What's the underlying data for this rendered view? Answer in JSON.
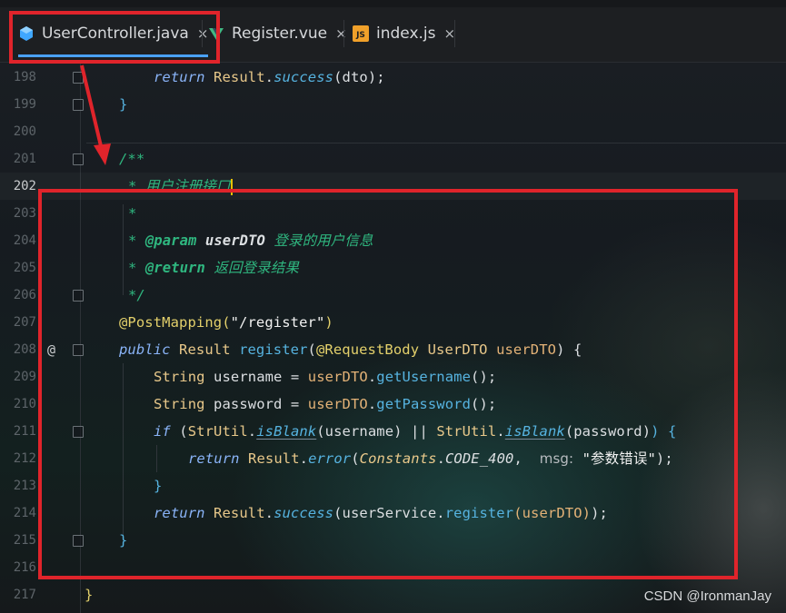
{
  "tabs": [
    {
      "label": "UserController.java",
      "close": "×",
      "icon": "java-class-icon",
      "active": true
    },
    {
      "label": "Register.vue",
      "close": "×",
      "icon": "vue-icon",
      "active": false
    },
    {
      "label": "index.js",
      "close": "×",
      "icon": "js-file-icon",
      "icon_text": "JS",
      "active": false
    }
  ],
  "lines": [
    {
      "num": "198"
    },
    {
      "num": "199"
    },
    {
      "num": "200"
    },
    {
      "num": "201"
    },
    {
      "num": "202"
    },
    {
      "num": "203"
    },
    {
      "num": "204"
    },
    {
      "num": "205"
    },
    {
      "num": "206"
    },
    {
      "num": "207"
    },
    {
      "num": "208"
    },
    {
      "num": "209"
    },
    {
      "num": "210"
    },
    {
      "num": "211"
    },
    {
      "num": "212"
    },
    {
      "num": "213"
    },
    {
      "num": "214"
    },
    {
      "num": "215"
    },
    {
      "num": "216"
    },
    {
      "num": "217"
    }
  ],
  "code": {
    "l198": {
      "kw": "return",
      "cls": "Result",
      "dot": ".",
      "fn": "success",
      "args": "(dto);"
    },
    "l199": "}",
    "l201": "/**",
    "l202": "* 用户注册接口",
    "l203": "*",
    "l204": {
      "star": "*",
      "tag": "@param",
      "name": "userDTO",
      "desc": "登录的用户信息"
    },
    "l205": {
      "star": "*",
      "tag": "@return",
      "desc": "返回登录结果"
    },
    "l206": "*/",
    "l207": {
      "anno": "@PostMapping",
      "open": "(",
      "str": "\"/register\"",
      "close": ")"
    },
    "l208": {
      "kw": "public",
      "type": "Result",
      "fn": "register",
      "p1": "(",
      "anno": "@RequestBody",
      "ptype": "UserDTO",
      "pname": "userDTO",
      "p2": ") {"
    },
    "l209": {
      "type": "String",
      "var": "username",
      "eq": " = ",
      "obj": "userDTO",
      "dot": ".",
      "fn": "getUsername",
      "end": "();"
    },
    "l210": {
      "type": "String",
      "var": "password",
      "eq": " = ",
      "obj": "userDTO",
      "dot": ".",
      "fn": "getPassword",
      "end": "();"
    },
    "l211": {
      "kw": "if",
      "o1": " (",
      "cls": "StrUtil",
      "dot": ".",
      "fn": "isBlank",
      "a1": "(username)",
      "or": " || ",
      "cls2": "StrUtil",
      "dot2": ".",
      "fn2": "isBlank",
      "a2": "(password)",
      "end": ") {"
    },
    "l212": {
      "kw": "return",
      "cls": "Result",
      "dot": ".",
      "fn": "error",
      "o": "(",
      "const_cls": "Constants",
      "dot2": ".",
      "const": "CODE_400",
      "comma": ", ",
      "hint": "msg:",
      "str": "\"参数错误\"",
      "end": ");"
    },
    "l213": "}",
    "l214": {
      "kw": "return",
      "cls": "Result",
      "dot": ".",
      "fn": "success",
      "o": "(",
      "svc": "userService",
      "dot2": ".",
      "fn2": "register",
      "arg": "(userDTO)",
      "end": ");"
    },
    "l215": "}",
    "l217": "}"
  },
  "gutter_marker": "@",
  "watermark": "CSDN @IronmanJay",
  "colors": {
    "keyword": "#8ab4f8",
    "class": "#e8c88a",
    "method": "#56b3e0",
    "comment": "#2fb67f",
    "annotation": "#e3d06b",
    "string": "#f2f2f2",
    "plain": "#dcdfe2",
    "highlight_box": "#e0242b"
  }
}
